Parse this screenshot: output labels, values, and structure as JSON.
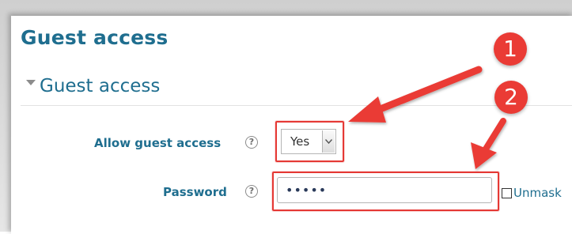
{
  "page": {
    "title": "Guest access"
  },
  "section": {
    "title": "Guest access",
    "expanded": true
  },
  "fields": {
    "allow_guest_access": {
      "label": "Allow guest access",
      "help_icon": "help-icon",
      "value": "Yes",
      "options": [
        "Yes"
      ]
    },
    "password": {
      "label": "Password",
      "help_icon": "help-icon",
      "value": "•••••",
      "unmask_label": "Unmask"
    }
  },
  "annotations": {
    "callout_1": "1",
    "callout_2": "2",
    "color": "#ea3b35"
  },
  "colors": {
    "heading": "#1f6e8f",
    "highlight": "#e53935"
  }
}
